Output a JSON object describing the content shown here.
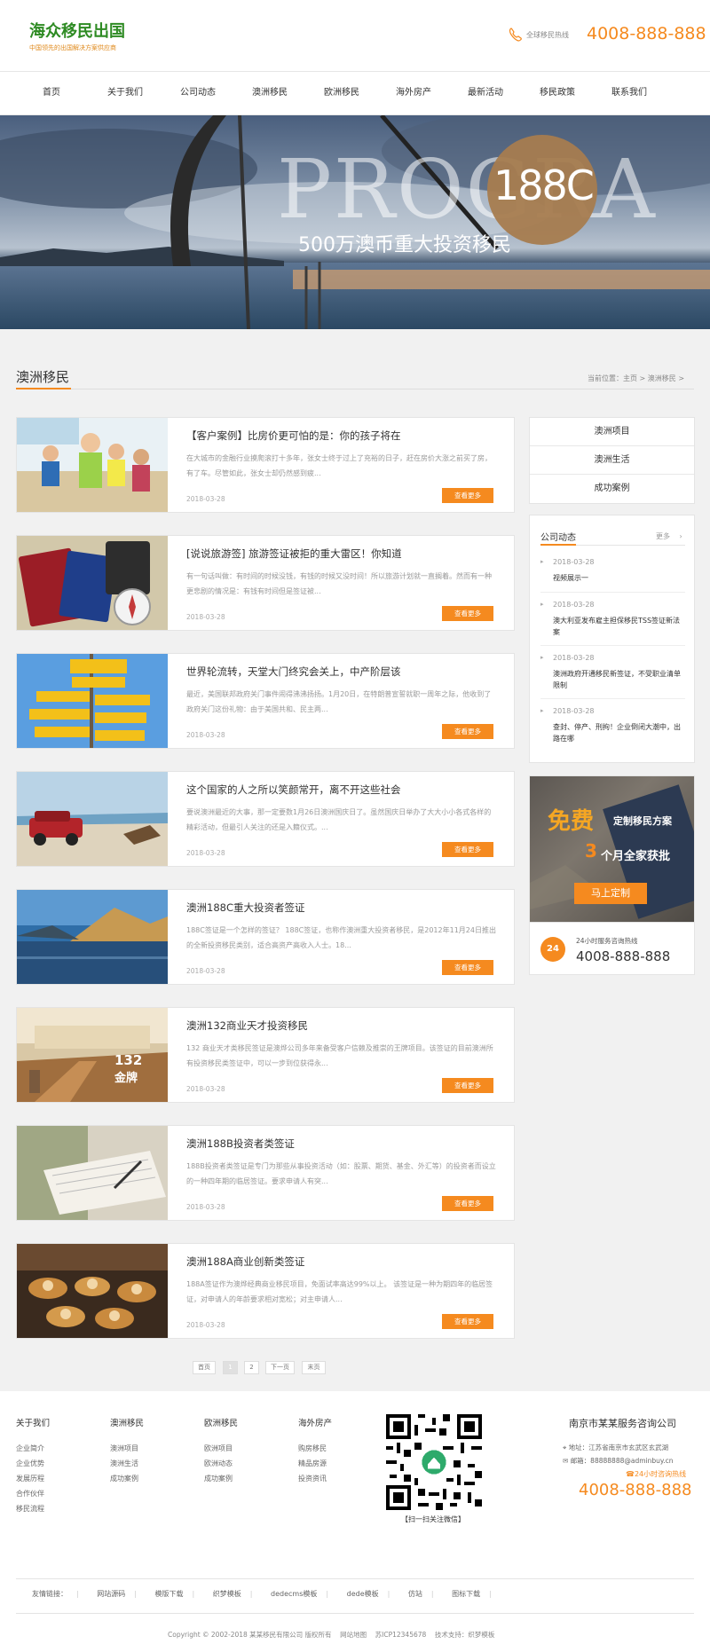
{
  "header": {
    "logo_title": "海众移民出国",
    "logo_sub": "中国领先的出国解决方案供应商",
    "hotline_label": "全球移民热线",
    "hotline_number": "4008-888-888"
  },
  "nav": [
    {
      "label": "首页"
    },
    {
      "label": "关于我们"
    },
    {
      "label": "公司动态"
    },
    {
      "label": "澳洲移民"
    },
    {
      "label": "欧洲移民"
    },
    {
      "label": "海外房产"
    },
    {
      "label": "最新活动"
    },
    {
      "label": "移民政策"
    },
    {
      "label": "联系我们"
    }
  ],
  "banner": {
    "bg_text": "PROGRA",
    "badge": "188C",
    "caption": "500万澳币重大投资移民"
  },
  "section": {
    "title": "澳洲移民",
    "breadcrumb": "当前位置：主页 > 澳洲移民 >"
  },
  "news": [
    {
      "title": "【客户案例】比房价更可怕的是：你的孩子将在",
      "desc": "在大城市的金融行业摸爬滚打十多年，张女士终于过上了充裕的日子，赶在房价大涨之前买了房，有了车。尽管如此，张女士却仍然感到疲...",
      "date": "2018-03-28",
      "more": "查看更多"
    },
    {
      "title": "[说说旅游签] 旅游签证被拒的重大雷区！你知道",
      "desc": "有一句话叫做：有时间的时候没钱，有钱的时候又没时间！所以旅游计划就一直搁着。然而有一种更悲剧的情况是：有钱有时间但是签证被...",
      "date": "2018-03-28",
      "more": "查看更多"
    },
    {
      "title": "世界轮流转，天堂大门终究会关上，中产阶层该",
      "desc": "最近，美国联邦政府关门事件闹得沸沸扬扬。1月20日，在特朗普宣誓就职一周年之际，他收到了政府关门这份礼物：由于美国共和、民主两...",
      "date": "2018-03-28",
      "more": "查看更多"
    },
    {
      "title": "这个国家的人之所以笑颜常开，离不开这些社会",
      "desc": "要说澳洲最近的大事，那一定要数1月26日澳洲国庆日了。虽然国庆日举办了大大小小各式各样的精彩活动，但最引人关注的还是入籍仪式。...",
      "date": "2018-03-28",
      "more": "查看更多"
    },
    {
      "title": "澳洲188C重大投资者签证",
      "desc": "188C签证是一个怎样的签证？ 188C签证，也称作澳洲重大投资者移民，是2012年11月24日推出的全新投资移民类别，适合高资产高收入人士。18...",
      "date": "2018-03-28",
      "more": "查看更多"
    },
    {
      "title": "澳洲132商业天才投资移民",
      "desc": "132 商业天才类移民签证是澳烨公司多年来备受客户信赖及推崇的王牌项目。该签证的目前澳洲所有投资移民类签证中，可以一步到位获得永...",
      "date": "2018-03-28",
      "more": "查看更多"
    },
    {
      "title": "澳洲188B投资者类签证",
      "desc": "188B投资者类签证是专门为那些从事投资活动（如：股票、期货、基金、外汇等）的投资者而设立的一种四年期的临居签证。要求申请人有突...",
      "date": "2018-03-28",
      "more": "查看更多"
    },
    {
      "title": "澳洲188A商业创新类签证",
      "desc": "188A签证作为澳烨经典商业移民项目，免面试率高达99%以上。 该签证是一种为期四年的临居签证，对申请人的年龄要求相对宽松；对主申请人...",
      "date": "2018-03-28",
      "more": "查看更多"
    }
  ],
  "thumb_labels": {
    "num": "132",
    "text": "金牌"
  },
  "pager": [
    "首页",
    "1",
    "2",
    "下一页",
    "末页"
  ],
  "sidebar": {
    "menu": [
      "澳洲项目",
      "澳洲生活",
      "成功案例"
    ],
    "news_title": "公司动态",
    "news_more": "更多",
    "news": [
      {
        "date": "2018-03-28",
        "text": "视频展示一"
      },
      {
        "date": "2018-03-28",
        "text": "澳大利亚发布雇主担保移民TSS签证新法案"
      },
      {
        "date": "2018-03-28",
        "text": "澳洲政府开通移民新签证，不受职业清单限制"
      },
      {
        "date": "2018-03-28",
        "text": "查封、停产、刑拘！企业倒闭大潮中，出路在哪"
      }
    ],
    "ad": {
      "free": "免费",
      "plan": "定制移民方案",
      "num": "3",
      "month": "个月全家获批",
      "button": "马上定制"
    },
    "phone_label": "24小时服务咨询热线",
    "phone_icon": "24",
    "phone_number": "4008-888-888"
  },
  "footer": {
    "cols": [
      {
        "title": "关于我们",
        "links": [
          "企业简介",
          "企业优势",
          "发展历程",
          "合作伙伴",
          "移民流程"
        ]
      },
      {
        "title": "澳洲移民",
        "links": [
          "澳洲项目",
          "澳洲生活",
          "成功案例"
        ]
      },
      {
        "title": "欧洲移民",
        "links": [
          "欧洲项目",
          "欧洲动态",
          "成功案例"
        ]
      },
      {
        "title": "海外房产",
        "links": [
          "购房移民",
          "精品房源",
          "投资资讯"
        ]
      }
    ],
    "qr_label": "【扫一扫关注微信】",
    "company": "南京市某某服务咨询公司",
    "address": "地址：江苏省南京市玄武区玄武湖",
    "email": "邮箱：88888888@adminbuy.cn",
    "hotline_label": "24小时咨询热线",
    "hotline_number": "4008-888-888",
    "friend_label": "友情链接：",
    "friend_links": [
      "网站源码",
      "模版下载",
      "织梦模板",
      "dedecms模板",
      "dede模板",
      "仿站",
      "图标下载"
    ],
    "copyright": "Copyright © 2002-2018 某某移民有限公司 版权所有    网站地图    苏ICP12345678    技术支持：织梦模板"
  },
  "colors": {
    "accent": "#f58a1f",
    "brand_green": "#2e8b23"
  }
}
